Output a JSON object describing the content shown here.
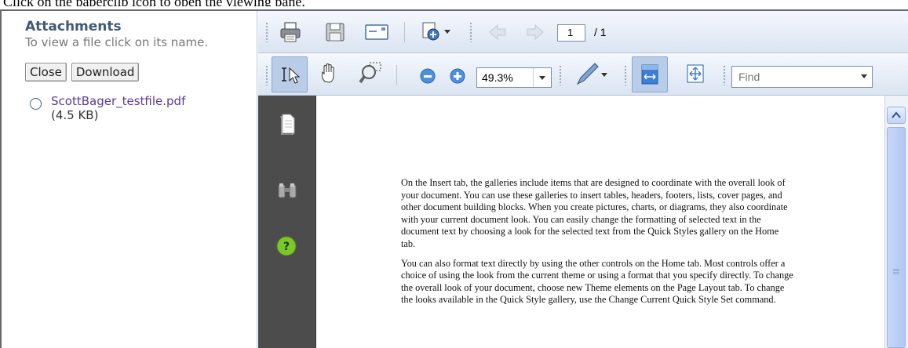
{
  "top_text": "Click on the paperclip icon to open the viewing pane.",
  "attachments": {
    "title": "Attachments",
    "description": "To view a file click on its name.",
    "close_label": "Close",
    "download_label": "Download",
    "file": {
      "name": "ScottBager_testfile.pdf",
      "size": "(4.5 KB)"
    }
  },
  "toolbar": {
    "page_current": "1",
    "page_total": "/ 1",
    "zoom": "49.3%",
    "find_placeholder": "Find"
  },
  "side_icons": [
    "pages-icon",
    "binoculars-icon",
    "help-icon"
  ],
  "document": {
    "paragraphs": [
      "On the Insert tab, the galleries include items that are designed to coordinate with the overall look of your document. You can use these galleries to insert tables, headers, footers, lists, cover pages, and other document building blocks. When you create pictures, charts, or diagrams, they also coordinate with your current document look. You can easily change the formatting of selected text in the document text by choosing a look for the selected text from the Quick Styles gallery on the Home tab.",
      "You can also format text directly by using the other controls on the Home tab. Most controls offer a choice of using the look from the current theme or using a format that you specify directly. To change the overall look of your document, choose new Theme elements on the Page Layout tab. To change the looks available in the Quick Style gallery, use the Change Current Quick Style Set command."
    ]
  },
  "colors": {
    "toolbar_top": "#f5f8fd",
    "toolbar_bottom": "#dbe4f2",
    "viewer_side": "#4c4c4c",
    "attach_title": "#435874",
    "file_link": "#5c3a9d"
  }
}
